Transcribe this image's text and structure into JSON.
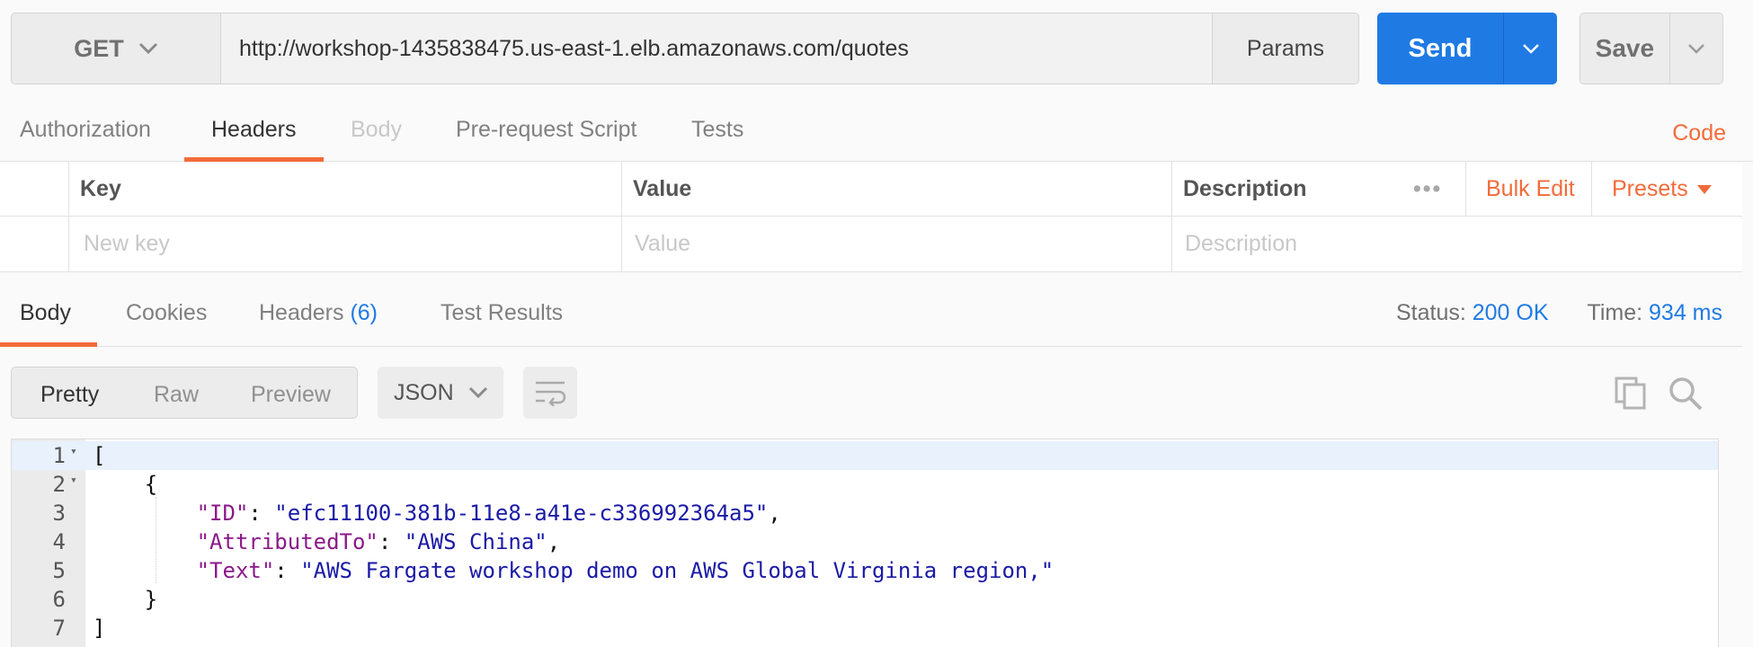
{
  "request": {
    "method": "GET",
    "url": "http://workshop-1435838475.us-east-1.elb.amazonaws.com/quotes",
    "params_label": "Params",
    "send_label": "Send",
    "save_label": "Save"
  },
  "request_tabs": [
    {
      "label": "Authorization",
      "state": "normal"
    },
    {
      "label": "Headers",
      "state": "active"
    },
    {
      "label": "Body",
      "state": "disabled"
    },
    {
      "label": "Pre-request Script",
      "state": "normal"
    },
    {
      "label": "Tests",
      "state": "normal"
    }
  ],
  "code_link": "Code",
  "headers_table": {
    "columns": [
      "Key",
      "Value",
      "Description"
    ],
    "more_label": "•••",
    "bulk_edit_label": "Bulk Edit",
    "presets_label": "Presets",
    "placeholders": {
      "key": "New key",
      "value": "Value",
      "description": "Description"
    }
  },
  "response_tabs": [
    {
      "label": "Body",
      "state": "active"
    },
    {
      "label": "Cookies",
      "state": "normal"
    },
    {
      "label": "Headers",
      "count": "(6)",
      "state": "normal"
    },
    {
      "label": "Test Results",
      "state": "normal"
    }
  ],
  "status": {
    "status_label": "Status:",
    "status_value": "200 OK",
    "time_label": "Time:",
    "time_value": "934 ms"
  },
  "view_modes": [
    "Pretty",
    "Raw",
    "Preview"
  ],
  "format": "JSON",
  "icons": {
    "method_dropdown": "chevron-down-icon",
    "send_dropdown": "chevron-down-icon",
    "save_dropdown": "chevron-down-icon",
    "presets_dropdown": "caret-down-icon",
    "wrap": "wrap-lines-icon",
    "copy": "copy-icon",
    "search": "search-icon"
  },
  "colors": {
    "accent_orange": "#f26b3a",
    "send_blue": "#1f7ae4",
    "json_key": "#8b1a89",
    "json_string": "#1a1aa6"
  },
  "response_body": {
    "lines": [
      {
        "num": "1",
        "fold": "▾",
        "parts": [
          [
            "p",
            "["
          ]
        ]
      },
      {
        "num": "2",
        "fold": "▾",
        "parts": [
          [
            "p",
            "    {"
          ]
        ]
      },
      {
        "num": "3",
        "fold": "",
        "parts": [
          [
            "p",
            "        "
          ],
          [
            "k",
            "\"ID\""
          ],
          [
            "p",
            ": "
          ],
          [
            "s",
            "\"efc11100-381b-11e8-a41e-c336992364a5\""
          ],
          [
            "p",
            ","
          ]
        ]
      },
      {
        "num": "4",
        "fold": "",
        "parts": [
          [
            "p",
            "        "
          ],
          [
            "k",
            "\"AttributedTo\""
          ],
          [
            "p",
            ": "
          ],
          [
            "s",
            "\"AWS China\""
          ],
          [
            "p",
            ","
          ]
        ]
      },
      {
        "num": "5",
        "fold": "",
        "parts": [
          [
            "p",
            "        "
          ],
          [
            "k",
            "\"Text\""
          ],
          [
            "p",
            ": "
          ],
          [
            "s",
            "\"AWS Fargate workshop demo on AWS Global Virginia region,\""
          ]
        ]
      },
      {
        "num": "6",
        "fold": "",
        "parts": [
          [
            "p",
            "    }"
          ]
        ]
      },
      {
        "num": "7",
        "fold": "",
        "parts": [
          [
            "p",
            "]"
          ]
        ]
      }
    ]
  }
}
